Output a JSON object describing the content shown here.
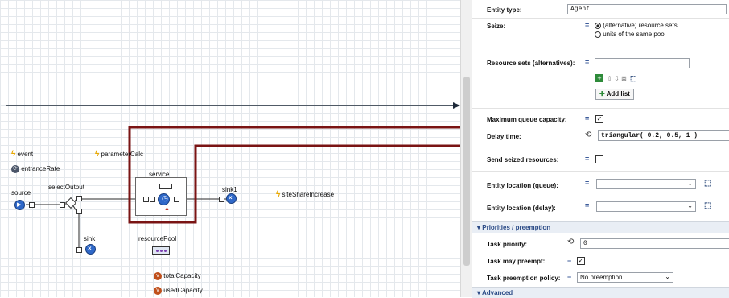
{
  "canvas": {
    "blocks": {
      "source": "source",
      "select_output": "selectOutput",
      "service": "service",
      "sink1": "sink1",
      "sink": "sink",
      "resource_pool": "resourcePool"
    },
    "elements": {
      "event": "event",
      "entrance_rate": "entranceRate",
      "parameter_calc": "parameterCalc",
      "site_share_increase": "siteShareIncrease",
      "total_capacity": "totalCapacity",
      "used_capacity": "usedCapacity"
    },
    "colors": {
      "highlight": "#7a1414",
      "node": "#2f68c8",
      "event_bolt": "#e8a800",
      "variable": "#c0501c"
    }
  },
  "properties": {
    "entity_type": {
      "label": "Entity type:",
      "value": "Agent"
    },
    "seize": {
      "label": "Seize:",
      "option_1": "(alternative) resource sets",
      "option_2": "units of the same pool",
      "selected": "(alternative) resource sets"
    },
    "resource_sets": {
      "label": "Resource sets (alternatives):",
      "add_list": "Add list"
    },
    "max_queue": {
      "label": "Maximum queue capacity:",
      "checked": true
    },
    "delay_time": {
      "label": "Delay time:",
      "value": "triangular( 0.2, 0.5, 1 )"
    },
    "send_seized": {
      "label": "Send seized resources:",
      "checked": false
    },
    "entity_location_queue": {
      "label": "Entity location (queue):"
    },
    "entity_location_delay": {
      "label": "Entity location (delay):"
    },
    "priorities_section": "Priorities / preemption",
    "task_priority": {
      "label": "Task priority:",
      "value": "0"
    },
    "task_may_preempt": {
      "label": "Task may preempt:",
      "checked": true
    },
    "task_preemption_policy": {
      "label": "Task preemption policy:",
      "value": "No preemption"
    },
    "advanced_section": "Advanced"
  }
}
